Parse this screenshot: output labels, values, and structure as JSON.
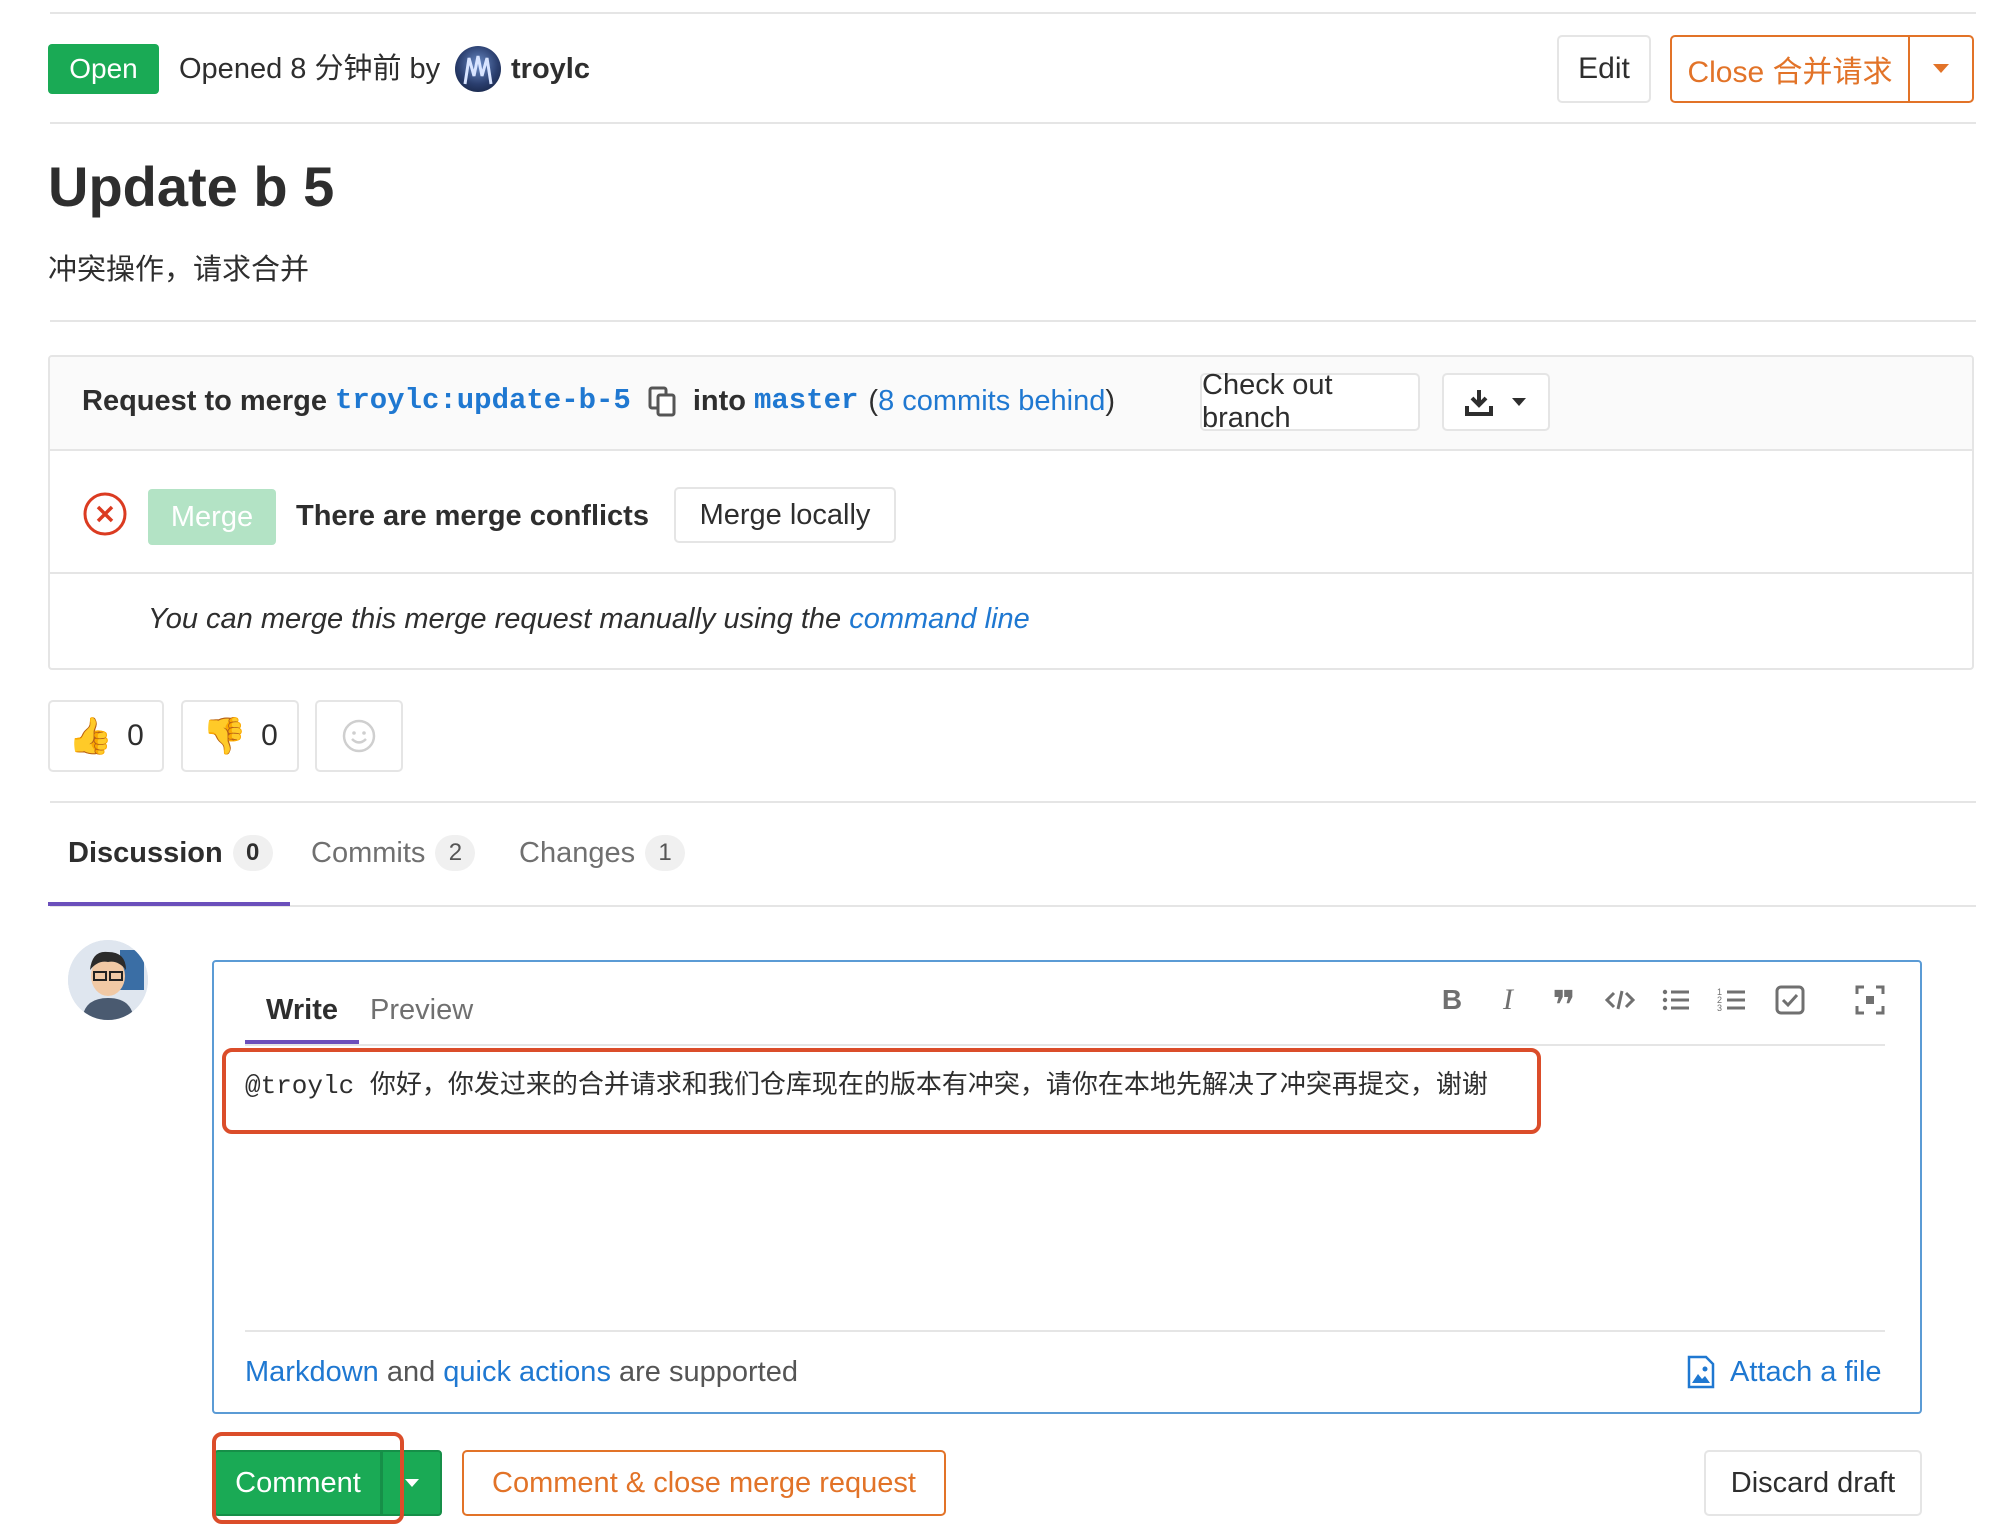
{
  "header": {
    "status": "Open",
    "opened_text": "Opened 8 分钟前 by",
    "author": "troylc",
    "edit_label": "Edit",
    "close_label": "Close 合并请求"
  },
  "mr": {
    "title": "Update b 5",
    "description": "冲突操作，请求合并"
  },
  "widget": {
    "request_label": "Request to merge",
    "source_branch": "troylc:update-b-5",
    "into_label": "into",
    "target_branch": "master",
    "open_paren": "(",
    "behind_text": "8 commits behind",
    "close_paren": ")",
    "checkout_label": "Check out branch",
    "merge_label": "Merge",
    "conflict_text": "There are merge conflicts",
    "merge_locally_label": "Merge locally",
    "manual_text": "You can merge this merge request manually using the",
    "command_line_link": "command line"
  },
  "awards": {
    "thumbsup_count": "0",
    "thumbsdown_count": "0"
  },
  "tabs": [
    {
      "label": "Discussion",
      "count": "0"
    },
    {
      "label": "Commits",
      "count": "2"
    },
    {
      "label": "Changes",
      "count": "1"
    }
  ],
  "editor": {
    "write_tab": "Write",
    "preview_tab": "Preview",
    "text": "@troylc 你好，你发过来的合并请求和我们仓库现在的版本有冲突，请你在本地先解决了冲突再提交，谢谢",
    "markdown_link": "Markdown",
    "and_text": "and",
    "quick_actions_link": "quick actions",
    "supported_text": "are supported",
    "attach_label": "Attach a file"
  },
  "actions": {
    "comment_label": "Comment",
    "comment_close_label": "Comment & close merge request",
    "discard_label": "Discard draft"
  },
  "colors": {
    "green": "#1aaa55",
    "orange": "#e27328",
    "link": "#1f78d1",
    "annotation_red": "#db4d2a",
    "editor_border": "#5b9bd5"
  }
}
